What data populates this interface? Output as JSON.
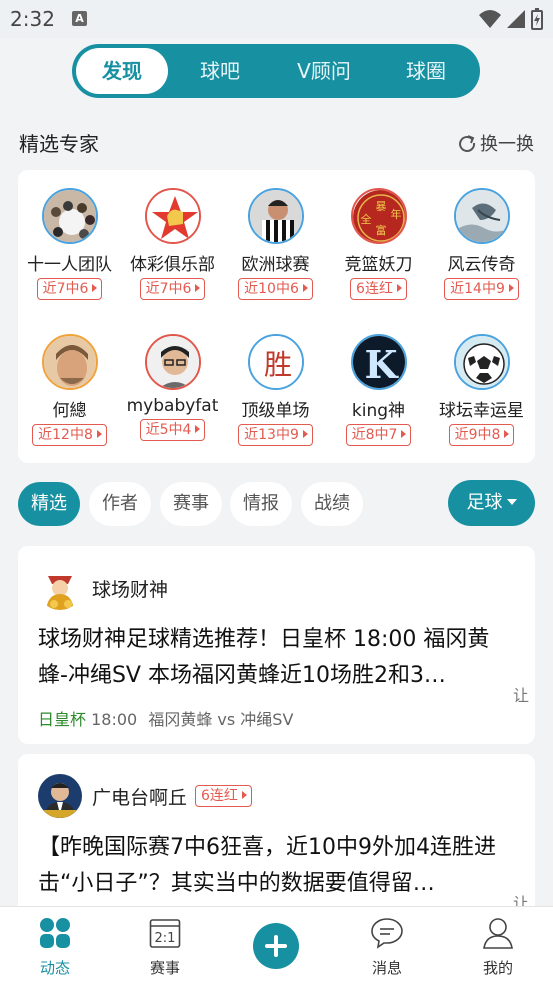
{
  "status_bar": {
    "time": "2:32",
    "notif_icon_letter": "A"
  },
  "top_tabs": [
    {
      "label": "发现",
      "active": true
    },
    {
      "label": "球吧",
      "active": false
    },
    {
      "label": "V顾问",
      "active": false
    },
    {
      "label": "球圈",
      "active": false
    }
  ],
  "experts_section": {
    "title": "精选专家",
    "refresh_label": "换一换"
  },
  "experts": [
    {
      "name": "十一人团队",
      "badge": "近7中6"
    },
    {
      "name": "体彩俱乐部",
      "badge": "近7中6"
    },
    {
      "name": "欧洲球赛",
      "badge": "近10中6"
    },
    {
      "name": "竞篮妖刀",
      "badge": "6连红",
      "avatar_text": "全暴富年"
    },
    {
      "name": "风云传奇",
      "badge": "近14中9"
    },
    {
      "name": "何總",
      "badge": "近12中8"
    },
    {
      "name": "mybabyfat",
      "badge": "近5中4"
    },
    {
      "name": "顶级单场",
      "badge": "近13中9",
      "avatar_text": "胜"
    },
    {
      "name": "king神",
      "badge": "近8中7",
      "avatar_text": "K"
    },
    {
      "name": "球坛幸运星",
      "badge": "近9中8"
    }
  ],
  "filters": {
    "chips": [
      {
        "label": "精选",
        "active": true
      },
      {
        "label": "作者",
        "active": false
      },
      {
        "label": "赛事",
        "active": false
      },
      {
        "label": "情报",
        "active": false
      },
      {
        "label": "战绩",
        "active": false
      }
    ],
    "sport": "足球"
  },
  "feed": [
    {
      "author": "球场财神",
      "title": "球场财神足球精选推荐！日皇杯 18:00 福冈黄蜂-冲绳SV 本场福冈黄蜂近10场胜2和3…",
      "league": "日皇杯",
      "time": "18:00",
      "match": "福冈黄蜂 vs 冲绳SV",
      "side_note": "让"
    },
    {
      "author": "广电台啊丘",
      "badge": "6连红",
      "title": "【昨晚国际赛7中6狂喜，近10中9外加4连胜进击“小日子”？其实当中的数据要值得留…",
      "side_note": "让"
    }
  ],
  "bottom_nav": [
    {
      "label": "动态",
      "active": true
    },
    {
      "label": "赛事",
      "active": false,
      "icon_text": "2:1"
    },
    {
      "label": "",
      "type": "plus"
    },
    {
      "label": "消息",
      "active": false
    },
    {
      "label": "我的",
      "active": false
    }
  ],
  "colors": {
    "accent": "#1790a2",
    "badge_red": "#e35b50",
    "league_green": "#2d8a2d"
  }
}
